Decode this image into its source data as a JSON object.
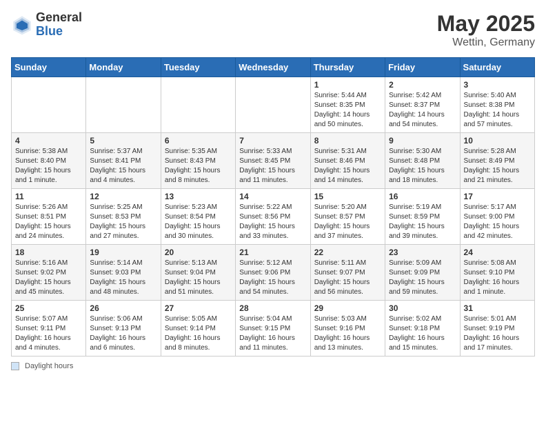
{
  "header": {
    "logo_general": "General",
    "logo_blue": "Blue",
    "month_year": "May 2025",
    "location": "Wettin, Germany"
  },
  "days_of_week": [
    "Sunday",
    "Monday",
    "Tuesday",
    "Wednesday",
    "Thursday",
    "Friday",
    "Saturday"
  ],
  "footer": {
    "note_label": "Daylight hours"
  },
  "weeks": [
    [
      {
        "day": "",
        "info": ""
      },
      {
        "day": "",
        "info": ""
      },
      {
        "day": "",
        "info": ""
      },
      {
        "day": "",
        "info": ""
      },
      {
        "day": "1",
        "info": "Sunrise: 5:44 AM\nSunset: 8:35 PM\nDaylight: 14 hours\nand 50 minutes."
      },
      {
        "day": "2",
        "info": "Sunrise: 5:42 AM\nSunset: 8:37 PM\nDaylight: 14 hours\nand 54 minutes."
      },
      {
        "day": "3",
        "info": "Sunrise: 5:40 AM\nSunset: 8:38 PM\nDaylight: 14 hours\nand 57 minutes."
      }
    ],
    [
      {
        "day": "4",
        "info": "Sunrise: 5:38 AM\nSunset: 8:40 PM\nDaylight: 15 hours\nand 1 minute."
      },
      {
        "day": "5",
        "info": "Sunrise: 5:37 AM\nSunset: 8:41 PM\nDaylight: 15 hours\nand 4 minutes."
      },
      {
        "day": "6",
        "info": "Sunrise: 5:35 AM\nSunset: 8:43 PM\nDaylight: 15 hours\nand 8 minutes."
      },
      {
        "day": "7",
        "info": "Sunrise: 5:33 AM\nSunset: 8:45 PM\nDaylight: 15 hours\nand 11 minutes."
      },
      {
        "day": "8",
        "info": "Sunrise: 5:31 AM\nSunset: 8:46 PM\nDaylight: 15 hours\nand 14 minutes."
      },
      {
        "day": "9",
        "info": "Sunrise: 5:30 AM\nSunset: 8:48 PM\nDaylight: 15 hours\nand 18 minutes."
      },
      {
        "day": "10",
        "info": "Sunrise: 5:28 AM\nSunset: 8:49 PM\nDaylight: 15 hours\nand 21 minutes."
      }
    ],
    [
      {
        "day": "11",
        "info": "Sunrise: 5:26 AM\nSunset: 8:51 PM\nDaylight: 15 hours\nand 24 minutes."
      },
      {
        "day": "12",
        "info": "Sunrise: 5:25 AM\nSunset: 8:53 PM\nDaylight: 15 hours\nand 27 minutes."
      },
      {
        "day": "13",
        "info": "Sunrise: 5:23 AM\nSunset: 8:54 PM\nDaylight: 15 hours\nand 30 minutes."
      },
      {
        "day": "14",
        "info": "Sunrise: 5:22 AM\nSunset: 8:56 PM\nDaylight: 15 hours\nand 33 minutes."
      },
      {
        "day": "15",
        "info": "Sunrise: 5:20 AM\nSunset: 8:57 PM\nDaylight: 15 hours\nand 37 minutes."
      },
      {
        "day": "16",
        "info": "Sunrise: 5:19 AM\nSunset: 8:59 PM\nDaylight: 15 hours\nand 39 minutes."
      },
      {
        "day": "17",
        "info": "Sunrise: 5:17 AM\nSunset: 9:00 PM\nDaylight: 15 hours\nand 42 minutes."
      }
    ],
    [
      {
        "day": "18",
        "info": "Sunrise: 5:16 AM\nSunset: 9:02 PM\nDaylight: 15 hours\nand 45 minutes."
      },
      {
        "day": "19",
        "info": "Sunrise: 5:14 AM\nSunset: 9:03 PM\nDaylight: 15 hours\nand 48 minutes."
      },
      {
        "day": "20",
        "info": "Sunrise: 5:13 AM\nSunset: 9:04 PM\nDaylight: 15 hours\nand 51 minutes."
      },
      {
        "day": "21",
        "info": "Sunrise: 5:12 AM\nSunset: 9:06 PM\nDaylight: 15 hours\nand 54 minutes."
      },
      {
        "day": "22",
        "info": "Sunrise: 5:11 AM\nSunset: 9:07 PM\nDaylight: 15 hours\nand 56 minutes."
      },
      {
        "day": "23",
        "info": "Sunrise: 5:09 AM\nSunset: 9:09 PM\nDaylight: 15 hours\nand 59 minutes."
      },
      {
        "day": "24",
        "info": "Sunrise: 5:08 AM\nSunset: 9:10 PM\nDaylight: 16 hours\nand 1 minute."
      }
    ],
    [
      {
        "day": "25",
        "info": "Sunrise: 5:07 AM\nSunset: 9:11 PM\nDaylight: 16 hours\nand 4 minutes."
      },
      {
        "day": "26",
        "info": "Sunrise: 5:06 AM\nSunset: 9:13 PM\nDaylight: 16 hours\nand 6 minutes."
      },
      {
        "day": "27",
        "info": "Sunrise: 5:05 AM\nSunset: 9:14 PM\nDaylight: 16 hours\nand 8 minutes."
      },
      {
        "day": "28",
        "info": "Sunrise: 5:04 AM\nSunset: 9:15 PM\nDaylight: 16 hours\nand 11 minutes."
      },
      {
        "day": "29",
        "info": "Sunrise: 5:03 AM\nSunset: 9:16 PM\nDaylight: 16 hours\nand 13 minutes."
      },
      {
        "day": "30",
        "info": "Sunrise: 5:02 AM\nSunset: 9:18 PM\nDaylight: 16 hours\nand 15 minutes."
      },
      {
        "day": "31",
        "info": "Sunrise: 5:01 AM\nSunset: 9:19 PM\nDaylight: 16 hours\nand 17 minutes."
      }
    ]
  ]
}
